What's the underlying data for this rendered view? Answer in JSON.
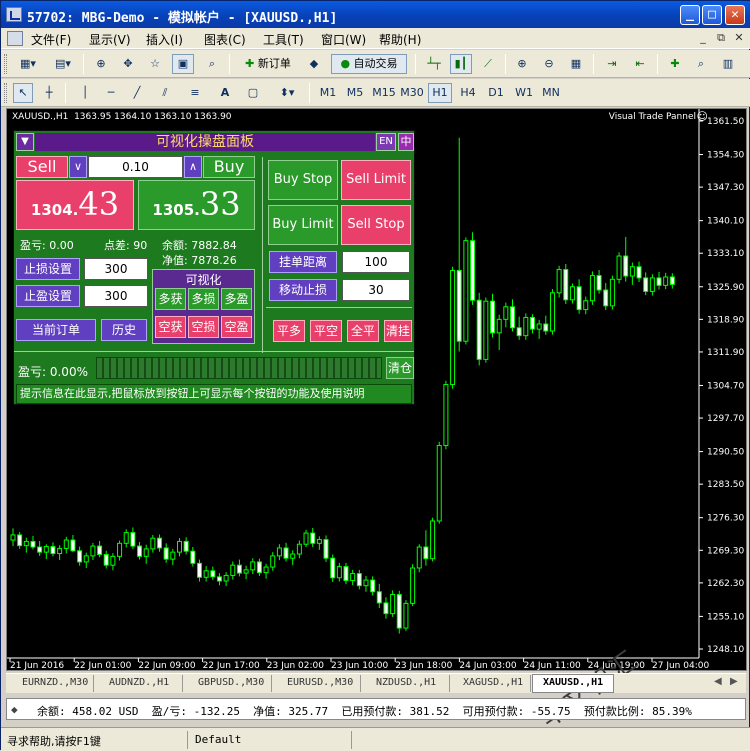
{
  "window": {
    "title": "57702: MBG-Demo - 模拟帐户 - [XAUUSD.,H1]"
  },
  "menu": {
    "items": [
      "文件(F)",
      "显示(V)",
      "插入(I)",
      "图表(C)",
      "工具(T)",
      "窗口(W)",
      "帮助(H)"
    ]
  },
  "toolbar": {
    "new_order": "新订单",
    "auto_trade": "自动交易",
    "timeframes": [
      "M1",
      "M5",
      "M15",
      "M30",
      "H1",
      "H4",
      "D1",
      "W1",
      "MN"
    ],
    "active_tf": "H1",
    "draw_labels": [
      "A"
    ]
  },
  "chart": {
    "symbol_info": "XAUUSD.,H1  1363.95 1364.10 1363.10 1363.90",
    "panel_label": "Visual Trade Pannel",
    "watermark": "华文智汇",
    "price_ticks": [
      "1361.50",
      "1354.30",
      "1347.30",
      "1340.10",
      "1333.10",
      "1325.90",
      "1318.90",
      "1311.90",
      "1304.70",
      "1297.70",
      "1290.50",
      "1283.50",
      "1276.30",
      "1269.30",
      "1262.30",
      "1255.10",
      "1248.10"
    ],
    "time_ticks": [
      "21 Jun 2016",
      "22 Jun 01:00",
      "22 Jun 09:00",
      "22 Jun 17:00",
      "23 Jun 02:00",
      "23 Jun 10:00",
      "23 Jun 18:00",
      "24 Jun 03:00",
      "24 Jun 11:00",
      "24 Jun 19:00",
      "27 Jun 04:00"
    ],
    "colors": {
      "bull": "#00ff00",
      "bear": "#00ff00",
      "axis": "#ffffff"
    }
  },
  "panel": {
    "title": "可视化操盘面板",
    "lang_en": "EN",
    "lang_cn": "中",
    "sell": "Sell",
    "buy": "Buy",
    "lot": "0.10",
    "bid_big": "1304.",
    "bid_small": "43",
    "ask_big": "1305.",
    "ask_small": "33",
    "profit": "盈亏: 0.00",
    "spread": "点差: 90",
    "balance": "余额: 7882.84",
    "equity": "净值: 7878.26",
    "sl_btn": "止损设置",
    "sl_val": "300",
    "tp_btn": "止盈设置",
    "tp_val": "300",
    "orders_btn": "当前订单",
    "history_btn": "历史",
    "vis_title": "可视化",
    "vis": [
      "多获",
      "多损",
      "多盈",
      "空获",
      "空损",
      "空盈"
    ],
    "buy_stop": "Buy Stop",
    "sell_limit": "Sell Limit",
    "buy_limit": "Buy Limit",
    "sell_stop": "Sell Stop",
    "pend_dist_btn": "挂单距离",
    "pend_dist_val": "100",
    "trail_btn": "移动止损",
    "trail_val": "30",
    "close_btns": [
      "平多",
      "平空",
      "全平",
      "清挂"
    ],
    "pnl_pct": "盈亏: 0.00%",
    "clear_btn": "清仓",
    "hint": "提示信息在此显示,把鼠标放到按钮上可显示每个按钮的功能及使用说明"
  },
  "tabs": [
    "EURNZD.,M30",
    "AUDNZD.,H1",
    "GBPUSD.,M30",
    "EURUSD.,M30",
    "NZDUSD.,H1",
    "XAGUSD.,H1",
    "XAUUSD.,H1"
  ],
  "active_tab": "XAUUSD.,H1",
  "info": {
    "text": "余额: 458.02 USD  盈/亏: -132.25  净值: 325.77  已用预付款: 381.52  可用预付款: -55.75  预付款比例: 85.39%"
  },
  "status": {
    "help": "寻求帮助,请按F1键",
    "profile": "Default"
  }
}
